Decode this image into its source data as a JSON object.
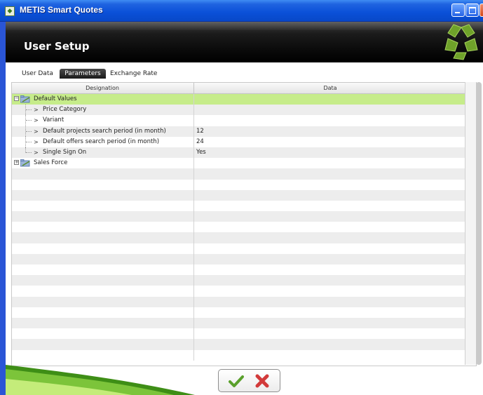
{
  "window": {
    "title": "METIS Smart Quotes"
  },
  "header": {
    "title": "User Setup"
  },
  "tabs": [
    {
      "label": "User Data",
      "active": false
    },
    {
      "label": "Parameters",
      "active": true
    },
    {
      "label": "Exchange Rate",
      "active": false
    }
  ],
  "grid": {
    "columns": [
      "Designation",
      "Data"
    ],
    "groups": [
      {
        "label": "Default Values",
        "expanded": true,
        "items": [
          {
            "label": "Price Category",
            "value": ""
          },
          {
            "label": "Variant",
            "value": ""
          },
          {
            "label": "Default projects search period (in month)",
            "value": "12"
          },
          {
            "label": "Default offers search period (in month)",
            "value": "24"
          },
          {
            "label": "Single Sign On",
            "value": "Yes"
          }
        ]
      },
      {
        "label": "Sales Force",
        "expanded": false,
        "items": []
      }
    ]
  },
  "actions": {
    "ok_icon": "check-icon",
    "cancel_icon": "cross-icon"
  },
  "colors": {
    "selected_group_row": "#c6ec8a",
    "logo_green": "#6fa22a",
    "ok_green": "#5aa02c",
    "cancel_red": "#d23a3a"
  }
}
